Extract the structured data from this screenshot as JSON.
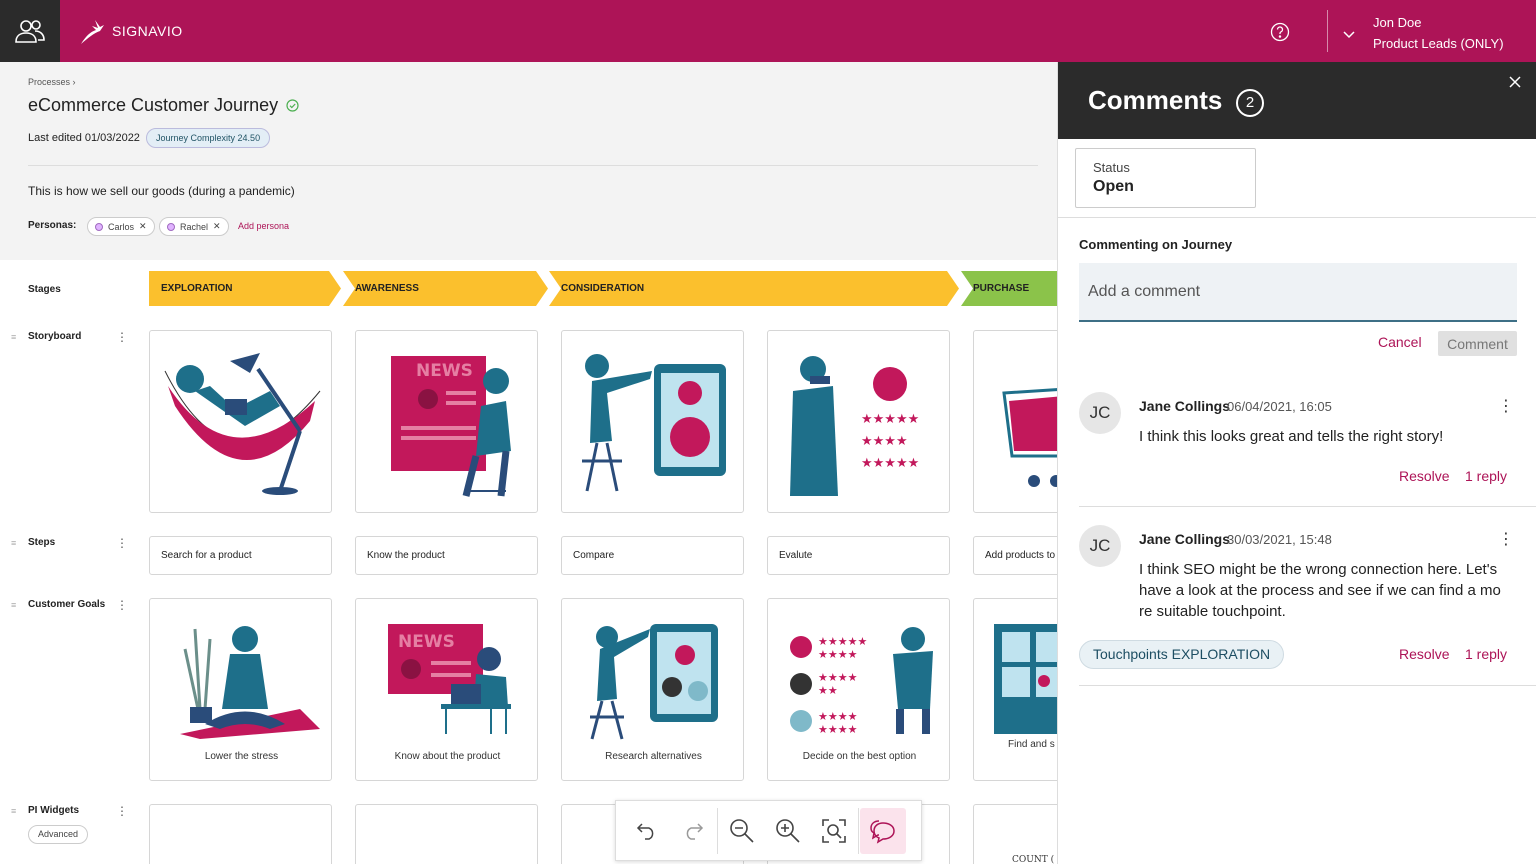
{
  "topbar": {
    "brand": "SIGNAVIO",
    "user_name": "Jon Doe",
    "user_role": "Product Leads (ONLY)"
  },
  "header": {
    "breadcrumb": "Processes",
    "title": "eCommerce Customer Journey",
    "last_edited": "Last edited 01/03/2022",
    "complexity_label": "Journey Complexity",
    "complexity_value": "24.50",
    "description": "This is how we sell our goods (during a pandemic)",
    "personas_label": "Personas:",
    "personas": [
      "Carlos",
      "Rachel"
    ],
    "add_persona": "Add persona"
  },
  "board": {
    "lanes": {
      "stages": "Stages",
      "storyboard": "Storyboard",
      "steps": "Steps",
      "goals": "Customer Goals",
      "widgets": "PI Widgets",
      "widgets_badge": "Advanced"
    },
    "stages": [
      {
        "label": "EXPLORATION",
        "color": "#fbc02d"
      },
      {
        "label": "AWARENESS",
        "color": "#fbc02d"
      },
      {
        "label": "CONSIDERATION",
        "color": "#fbc02d"
      },
      {
        "label": "PURCHASE",
        "color": "#8bc34a"
      }
    ],
    "steps": [
      "Search for a product",
      "Know the product",
      "Compare",
      "Evalute",
      "Add products to"
    ],
    "goals": [
      "Lower the stress",
      "Know about the product",
      "Research alternatives",
      "Decide on the best option",
      "Find and s easily, g"
    ],
    "storyboard_images": [
      "hammock-lamp-illustration",
      "newspaper-reader-illustration",
      "tablet-compare-illustration",
      "rating-stars-illustration",
      "shopping-cart-illustration"
    ],
    "goal_images": [
      "yoga-meditation-illustration",
      "news-laptop-illustration",
      "tablet-research-illustration",
      "decision-rating-illustration",
      "shop-window-illustration"
    ],
    "widget_partial": "COUNT ("
  },
  "toolbar": {
    "icons": [
      "undo-icon",
      "redo-icon",
      "zoom-out-icon",
      "zoom-in-icon",
      "fit-screen-icon",
      "comments-icon"
    ]
  },
  "comments": {
    "title": "Comments",
    "count": "2",
    "status_label": "Status",
    "status_value": "Open",
    "commenting_on": "Commenting on Journey",
    "placeholder": "Add a comment",
    "cancel": "Cancel",
    "submit": "Comment",
    "items": [
      {
        "initials": "JC",
        "author": "Jane Collings",
        "date": "06/04/2021, 16:05",
        "text": "I think this looks great and tells the right story!",
        "resolve": "Resolve",
        "replies": "1 reply"
      },
      {
        "initials": "JC",
        "author": "Jane Collings",
        "date": "30/03/2021, 15:48",
        "text": "I think SEO might be the wrong connection here. Let's have a look at the process and see if we can find a mo re suitable touchpoint.",
        "tag_label": "Touchpoints",
        "tag_value": "EXPLORATION",
        "resolve": "Resolve",
        "replies": "1 reply"
      }
    ]
  },
  "colors": {
    "brand": "#ad1457",
    "dark": "#2b2b2b",
    "illus_teal": "#1e6f8a",
    "illus_magenta": "#c2185b"
  }
}
